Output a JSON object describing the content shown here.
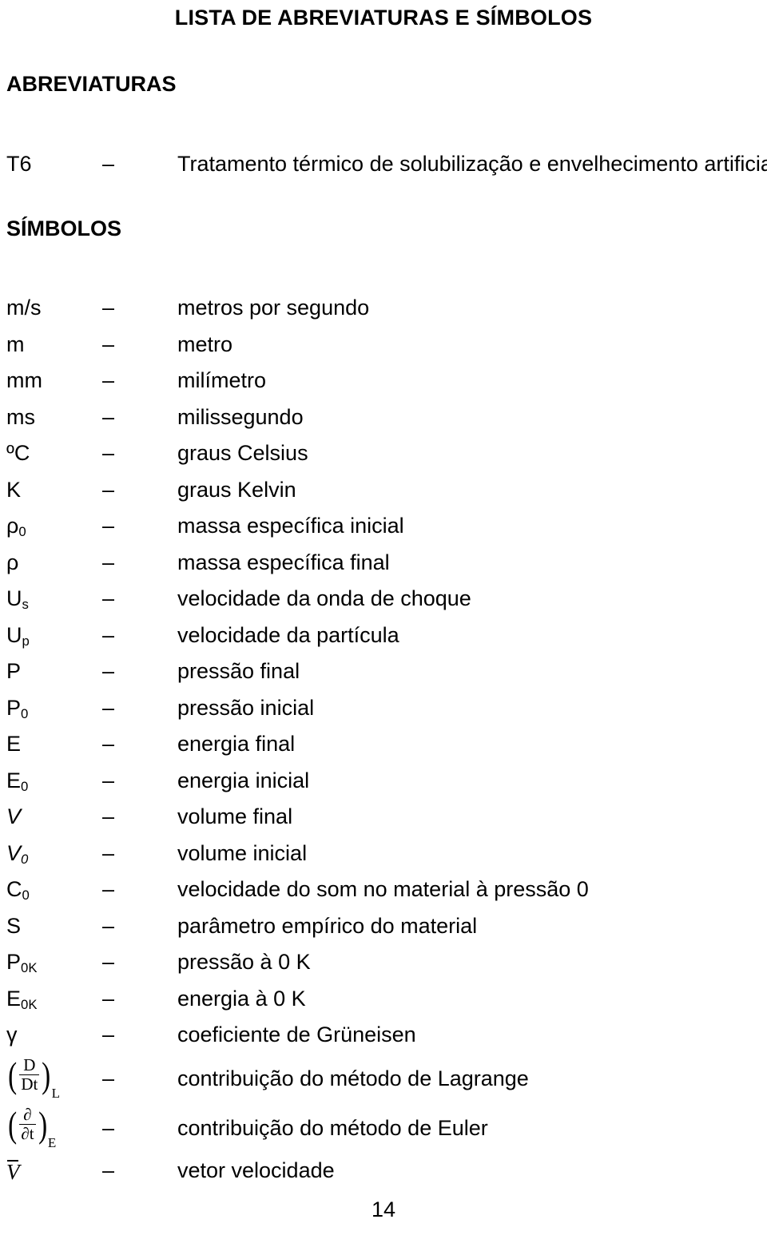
{
  "document": {
    "title": "LISTA DE ABREVIATURAS E SÍMBOLOS",
    "page_number": "14",
    "separator": "–"
  },
  "sections": [
    {
      "heading": "ABREVIATURAS",
      "entries": [
        {
          "symbol": "T6",
          "base": "T6",
          "sub": "",
          "description": "Tratamento térmico de solubilização e envelhecimento artificial"
        }
      ]
    },
    {
      "heading": "SÍMBOLOS",
      "entries": [
        {
          "symbol": "m/s",
          "base": "m/s",
          "sub": "",
          "description": "metros por segundo"
        },
        {
          "symbol": "m",
          "base": "m",
          "sub": "",
          "description": "metro"
        },
        {
          "symbol": "mm",
          "base": "mm",
          "sub": "",
          "description": "milímetro"
        },
        {
          "symbol": "ms",
          "base": "ms",
          "sub": "",
          "description": "milissegundo"
        },
        {
          "symbol": "ºC",
          "base": "ºC",
          "sub": "",
          "description": "graus Celsius"
        },
        {
          "symbol": "K",
          "base": "K",
          "sub": "",
          "description": "graus Kelvin"
        },
        {
          "symbol": "ρ0",
          "base": "ρ",
          "sub": "0",
          "description": "massa específica inicial"
        },
        {
          "symbol": "ρ",
          "base": "ρ",
          "sub": "",
          "description": "massa específica final"
        },
        {
          "symbol": "Us",
          "base": "U",
          "sub": "s",
          "description": "velocidade da onda de choque"
        },
        {
          "symbol": "Up",
          "base": "U",
          "sub": "p",
          "description": "velocidade da partícula"
        },
        {
          "symbol": "P",
          "base": "P",
          "sub": "",
          "description": "pressão final"
        },
        {
          "symbol": "P0",
          "base": "P",
          "sub": "0",
          "description": "pressão inicial"
        },
        {
          "symbol": "E",
          "base": "E",
          "sub": "",
          "description": "energia final"
        },
        {
          "symbol": "E0",
          "base": "E",
          "sub": "0",
          "description": "energia inicial"
        },
        {
          "symbol": "V",
          "base": "V",
          "sub": "",
          "description": "volume final",
          "italic": true
        },
        {
          "symbol": "V0",
          "base": "V",
          "sub": "0",
          "description": "volume inicial",
          "italic": true
        },
        {
          "symbol": "C0",
          "base": "C",
          "sub": "0",
          "description": "velocidade do som no material à pressão 0"
        },
        {
          "symbol": "S",
          "base": "S",
          "sub": "",
          "description": "parâmetro empírico do material"
        },
        {
          "symbol": "P0K",
          "base": "P",
          "sub": "0K",
          "description": "pressão à 0 K"
        },
        {
          "symbol": "E0K",
          "base": "E",
          "sub": "0K",
          "description": "energia à 0 K"
        },
        {
          "symbol": "γ",
          "base": "γ",
          "sub": "",
          "description": "coeficiente de Grüneisen"
        }
      ],
      "special_entries": [
        {
          "kind": "derivative-fraction",
          "numerator": "D",
          "denominator": "Dt",
          "subscript": "L",
          "description": "contribuição do método de Lagrange"
        },
        {
          "kind": "derivative-fraction",
          "numerator": "∂",
          "denominator": "∂t",
          "subscript": "E",
          "description": "contribuição do método de Euler"
        },
        {
          "kind": "overbar-symbol",
          "base": "V",
          "description": "vetor velocidade"
        }
      ]
    }
  ]
}
